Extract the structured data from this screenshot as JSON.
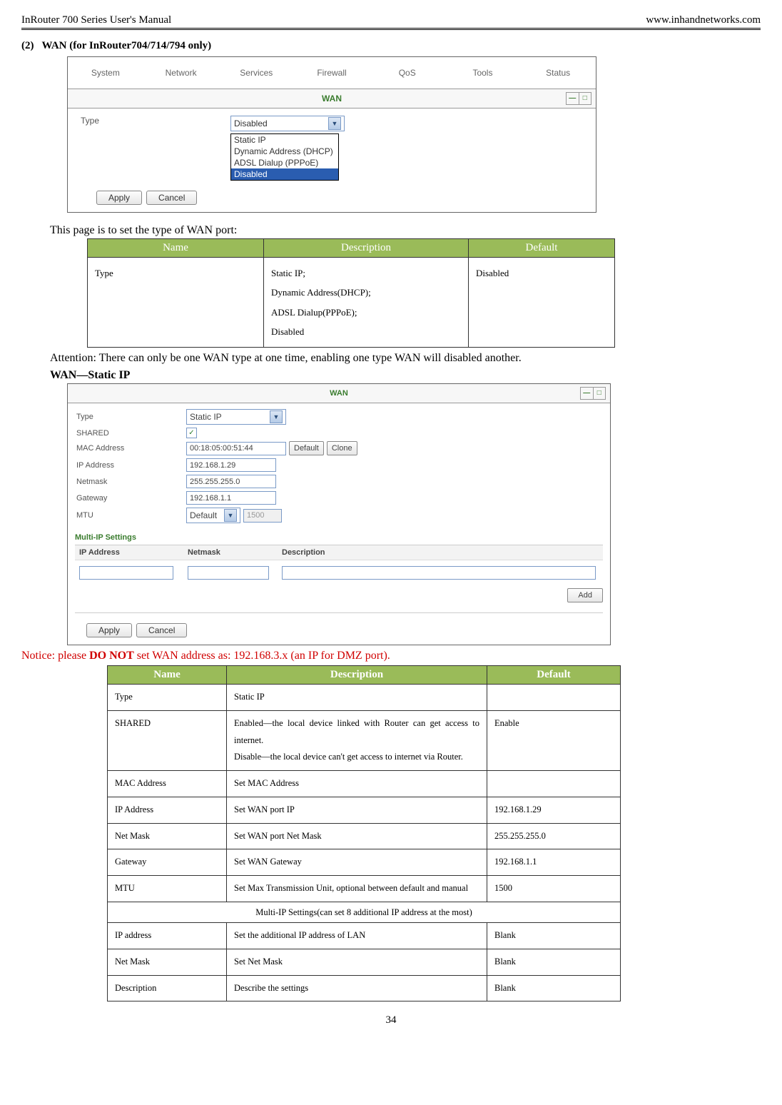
{
  "header": {
    "left": "InRouter 700 Series User's Manual",
    "right": "www.inhandnetworks.com"
  },
  "section_index": "(2)",
  "section_title": "WAN (for InRouter704/714/794 only)",
  "nav": {
    "tabs": [
      "System",
      "Network",
      "Services",
      "Firewall",
      "QoS",
      "Tools",
      "Status"
    ],
    "panel_title": "WAN",
    "type_label": "Type",
    "selected_value": "Disabled",
    "options": [
      "Static IP",
      "Dynamic Address (DHCP)",
      "ADSL Dialup (PPPoE)",
      "Disabled"
    ],
    "apply": "Apply",
    "cancel": "Cancel"
  },
  "intro_text": "This page is to set the type of WAN port:",
  "table1": {
    "headers": [
      "Name",
      "Description",
      "Default"
    ],
    "row": {
      "name": "Type",
      "desc_lines": [
        "Static IP;",
        "Dynamic Address(DHCP);",
        "ADSL Dialup(PPPoE);",
        "Disabled"
      ],
      "default": "Disabled"
    }
  },
  "attention": "Attention: There can only be one WAN type at one time, enabling one type WAN will disabled another.",
  "static_title": "WAN—Static IP",
  "staticform": {
    "panel_title": "WAN",
    "type_label": "Type",
    "type_value": "Static IP",
    "shared_label": "SHARED",
    "shared_checked": true,
    "mac_label": "MAC Address",
    "mac_value": "00:18:05:00:51:44",
    "mac_default_btn": "Default",
    "mac_clone_btn": "Clone",
    "ip_label": "IP Address",
    "ip_value": "192.168.1.29",
    "netmask_label": "Netmask",
    "netmask_value": "255.255.255.0",
    "gateway_label": "Gateway",
    "gateway_value": "192.168.1.1",
    "mtu_label": "MTU",
    "mtu_mode": "Default",
    "mtu_value": "1500",
    "multi_title": "Multi-IP Settings",
    "multi_headers": [
      "IP Address",
      "Netmask",
      "Description"
    ],
    "add_btn": "Add",
    "apply": "Apply",
    "cancel": "Cancel"
  },
  "notice_prefix": "Notice: please ",
  "notice_bold": "DO NOT",
  "notice_suffix": " set WAN address as: 192.168.3.x (an IP for DMZ port).",
  "table2": {
    "headers": [
      "Name",
      "Description",
      "Default"
    ],
    "rows": [
      {
        "name": "Type",
        "desc": "Static IP",
        "def": ""
      },
      {
        "name": "SHARED",
        "desc": "Enabled—the local device linked with Router can get access to internet.\nDisable—the local device can't get access to internet via Router.",
        "def": "Enable"
      },
      {
        "name": "MAC Address",
        "desc": "Set MAC Address",
        "def": ""
      },
      {
        "name": "IP Address",
        "desc": "Set WAN port IP",
        "def": "192.168.1.29"
      },
      {
        "name": "Net Mask",
        "desc": "Set WAN port Net Mask",
        "def": "255.255.255.0"
      },
      {
        "name": "Gateway",
        "desc": "Set WAN Gateway",
        "def": "192.168.1.1"
      },
      {
        "name": "MTU",
        "desc": "Set Max Transmission Unit, optional between default and manual",
        "def": "1500"
      }
    ],
    "mid_note": "Multi-IP Settings(can set 8 additional IP address at the most)",
    "rows2": [
      {
        "name": "IP address",
        "desc": "Set the additional IP address of LAN",
        "def": "Blank"
      },
      {
        "name": "Net Mask",
        "desc": "Set Net Mask",
        "def": "Blank"
      },
      {
        "name": "Description",
        "desc": "Describe the settings",
        "def": "Blank"
      }
    ]
  },
  "page_number": "34"
}
